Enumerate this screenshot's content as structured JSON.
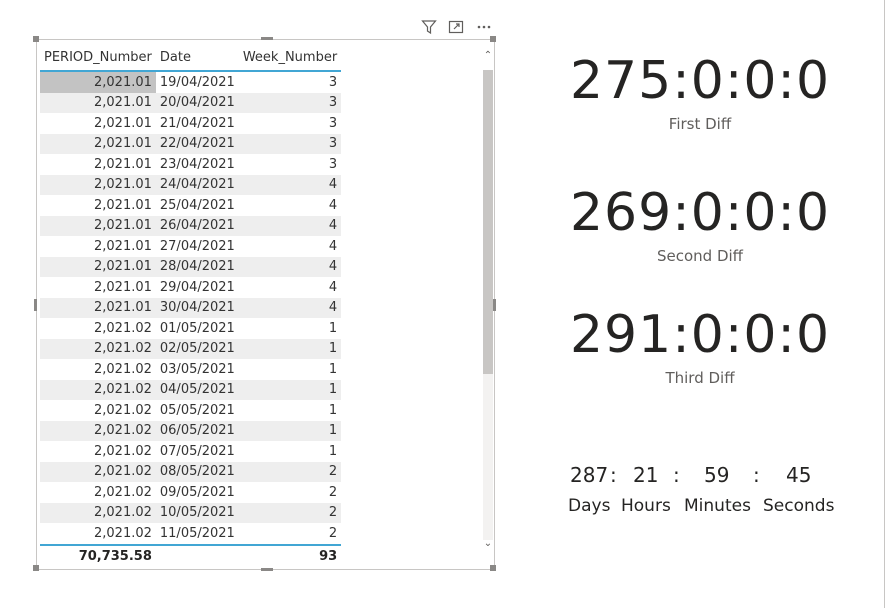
{
  "header_icons": [
    "filter-icon",
    "focus-mode-icon",
    "more-options-icon"
  ],
  "table": {
    "columns": [
      "PERIOD_Number",
      "Date",
      "Week_Number"
    ],
    "rows": [
      [
        "2,021.01",
        "19/04/2021",
        "3"
      ],
      [
        "2,021.01",
        "20/04/2021",
        "3"
      ],
      [
        "2,021.01",
        "21/04/2021",
        "3"
      ],
      [
        "2,021.01",
        "22/04/2021",
        "3"
      ],
      [
        "2,021.01",
        "23/04/2021",
        "3"
      ],
      [
        "2,021.01",
        "24/04/2021",
        "4"
      ],
      [
        "2,021.01",
        "25/04/2021",
        "4"
      ],
      [
        "2,021.01",
        "26/04/2021",
        "4"
      ],
      [
        "2,021.01",
        "27/04/2021",
        "4"
      ],
      [
        "2,021.01",
        "28/04/2021",
        "4"
      ],
      [
        "2,021.01",
        "29/04/2021",
        "4"
      ],
      [
        "2,021.01",
        "30/04/2021",
        "4"
      ],
      [
        "2,021.02",
        "01/05/2021",
        "1"
      ],
      [
        "2,021.02",
        "02/05/2021",
        "1"
      ],
      [
        "2,021.02",
        "03/05/2021",
        "1"
      ],
      [
        "2,021.02",
        "04/05/2021",
        "1"
      ],
      [
        "2,021.02",
        "05/05/2021",
        "1"
      ],
      [
        "2,021.02",
        "06/05/2021",
        "1"
      ],
      [
        "2,021.02",
        "07/05/2021",
        "1"
      ],
      [
        "2,021.02",
        "08/05/2021",
        "2"
      ],
      [
        "2,021.02",
        "09/05/2021",
        "2"
      ],
      [
        "2,021.02",
        "10/05/2021",
        "2"
      ],
      [
        "2,021.02",
        "11/05/2021",
        "2"
      ]
    ],
    "totals": [
      "70,735.58",
      "",
      "93"
    ]
  },
  "cards": [
    {
      "value": "275:0:0:0",
      "label": "First Diff"
    },
    {
      "value": "269:0:0:0",
      "label": "Second Diff"
    },
    {
      "value": "291:0:0:0",
      "label": "Third Diff"
    }
  ],
  "countdown": {
    "days": "287",
    "hours": "21",
    "minutes": "59",
    "seconds": "45",
    "separator": ":",
    "labels": {
      "days": "Days",
      "hours": "Hours",
      "minutes": "Minutes",
      "seconds": "Seconds"
    }
  },
  "colors": {
    "accent": "#41a6d4",
    "alt_row": "#eeeeee",
    "selected_cell": "#c3c3c3"
  }
}
